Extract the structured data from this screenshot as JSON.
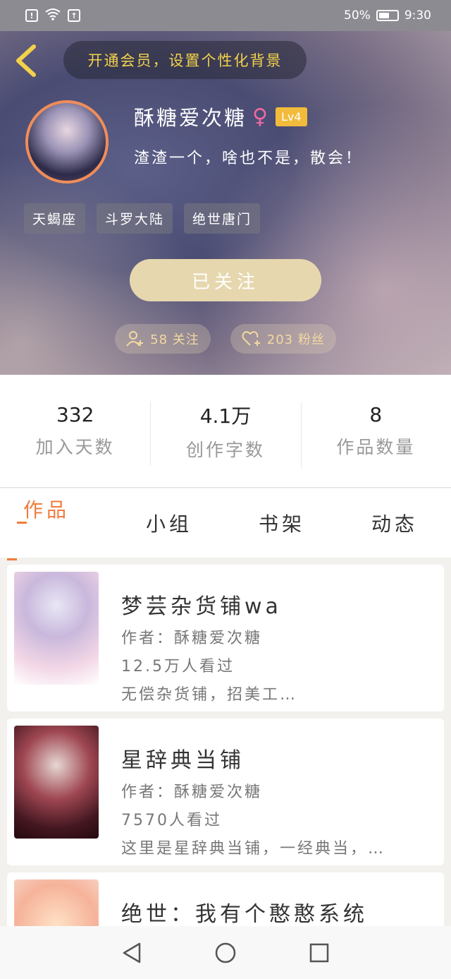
{
  "status_bar": {
    "battery": "50%",
    "time": "9:30"
  },
  "header": {
    "member_banner": "开通会员，设置个性化背景",
    "username": "酥糖爱次糖",
    "gender_symbol": "♀",
    "level": "Lv4",
    "bio": "渣渣一个，啥也不是，散会！",
    "tags": [
      "天蝎座",
      "斗罗大陆",
      "绝世唐门"
    ],
    "follow_button": "已关注",
    "following": "58 关注",
    "fans": "203 粉丝"
  },
  "stats": [
    {
      "value": "332",
      "label": "加入天数"
    },
    {
      "value": "4.1万",
      "label": "创作字数"
    },
    {
      "value": "8",
      "label": "作品数量"
    }
  ],
  "tabs": [
    "作品",
    "小组",
    "书架",
    "动态"
  ],
  "works": [
    {
      "title": "梦芸杂货铺wa",
      "author": "作者：酥糖爱次糖",
      "views": "12.5万人看过",
      "desc": "无偿杂货铺，招美工…"
    },
    {
      "title": "星辞典当铺",
      "author": "作者：酥糖爱次糖",
      "views": "7570人看过",
      "desc": "这里是星辞典当铺，一经典当，…"
    },
    {
      "title": "绝世：我有个憨憨系统",
      "author": "",
      "views": "",
      "desc": ""
    }
  ],
  "colors": {
    "accent": "#f07b3d",
    "banner_text": "#f3d24a",
    "level_badge": "#f2bb3b",
    "follow_button": "#e6d7ae"
  },
  "icons": {
    "back": "chevron-left-icon",
    "following": "user-plus-icon",
    "fans": "heart-plus-icon",
    "nav": [
      "triangle-back-icon",
      "circle-home-icon",
      "square-recents-icon"
    ]
  }
}
